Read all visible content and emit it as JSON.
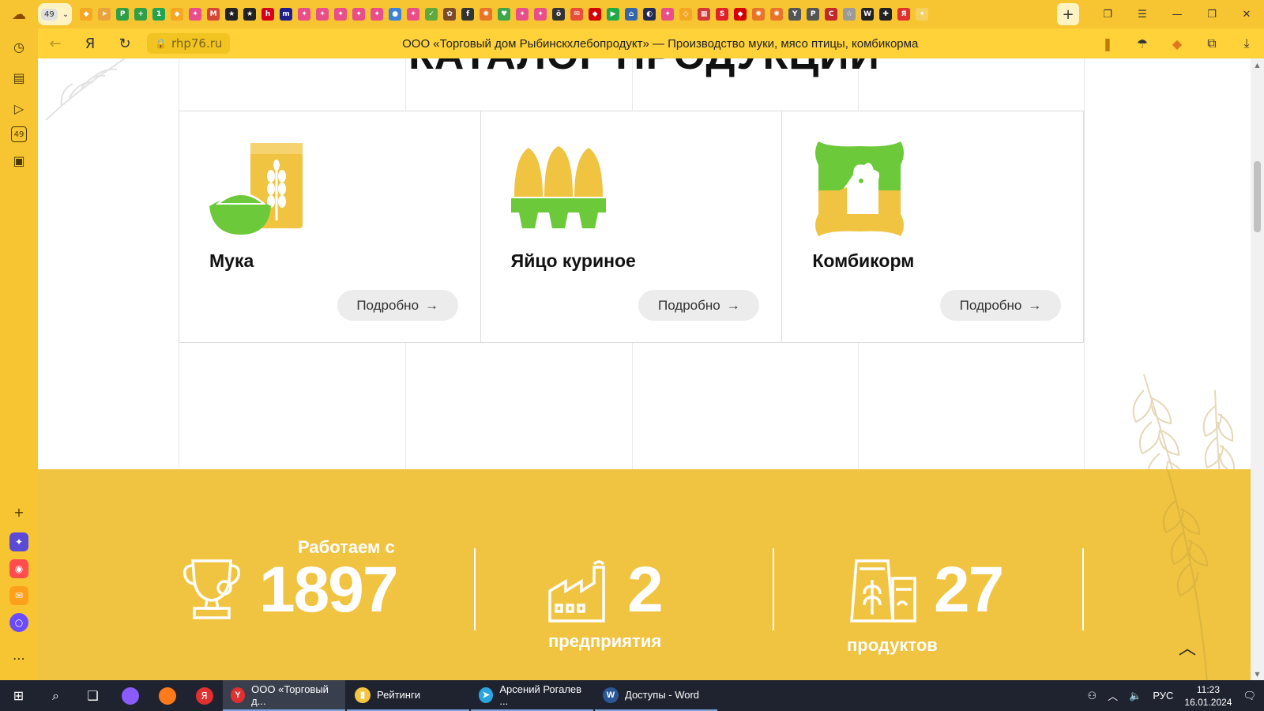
{
  "browser": {
    "tab_counter": "49",
    "tab_icons": [
      {
        "name": "tab-icon-1",
        "color": "#f5a623",
        "glyph": "◆"
      },
      {
        "name": "tab-icon-2",
        "color": "#e8a33a",
        "glyph": "➤"
      },
      {
        "name": "tab-icon-3",
        "color": "#2e9f46",
        "glyph": "P"
      },
      {
        "name": "tab-icon-4",
        "color": "#2e9f46",
        "glyph": "+"
      },
      {
        "name": "tab-icon-5",
        "color": "#22a352",
        "glyph": "1"
      },
      {
        "name": "tab-icon-6",
        "color": "#f5a623",
        "glyph": "◆"
      },
      {
        "name": "tab-icon-7",
        "color": "#e84e89",
        "glyph": "✦"
      },
      {
        "name": "tab-icon-8",
        "color": "#d44638",
        "glyph": "M"
      },
      {
        "name": "tab-icon-9",
        "color": "#222222",
        "glyph": "★"
      },
      {
        "name": "tab-icon-10",
        "color": "#222222",
        "glyph": "★"
      },
      {
        "name": "tab-icon-11",
        "color": "#d6001c",
        "glyph": "h"
      },
      {
        "name": "tab-icon-12",
        "color": "#1e1e8c",
        "glyph": "m"
      },
      {
        "name": "tab-icon-13",
        "color": "#e84e89",
        "glyph": "✦"
      },
      {
        "name": "tab-icon-14",
        "color": "#e84e89",
        "glyph": "✦"
      },
      {
        "name": "tab-icon-15",
        "color": "#e84e89",
        "glyph": "✦"
      },
      {
        "name": "tab-icon-16",
        "color": "#e84e89",
        "glyph": "✦"
      },
      {
        "name": "tab-icon-17",
        "color": "#e84e89",
        "glyph": "✦"
      },
      {
        "name": "tab-icon-18",
        "color": "#3b82d6",
        "glyph": "●"
      },
      {
        "name": "tab-icon-19",
        "color": "#e84e89",
        "glyph": "✦"
      },
      {
        "name": "tab-icon-20",
        "color": "#5fa83b",
        "glyph": "✓"
      },
      {
        "name": "tab-icon-21",
        "color": "#7a4a2a",
        "glyph": "✿"
      },
      {
        "name": "tab-icon-22",
        "color": "#333333",
        "glyph": "f"
      },
      {
        "name": "tab-icon-23",
        "color": "#e8742a",
        "glyph": "✺"
      },
      {
        "name": "tab-icon-24",
        "color": "#3aa84a",
        "glyph": "♥"
      },
      {
        "name": "tab-icon-25",
        "color": "#e84e89",
        "glyph": "✦"
      },
      {
        "name": "tab-icon-26",
        "color": "#e84e89",
        "glyph": "✦"
      },
      {
        "name": "tab-icon-27",
        "color": "#333333",
        "glyph": "ö"
      },
      {
        "name": "tab-icon-28",
        "color": "#e84e3a",
        "glyph": "✉"
      },
      {
        "name": "tab-icon-29",
        "color": "#d40000",
        "glyph": "◆"
      },
      {
        "name": "tab-icon-30",
        "color": "#1faa4a",
        "glyph": "▶"
      },
      {
        "name": "tab-icon-31",
        "color": "#3366aa",
        "glyph": "⌂"
      },
      {
        "name": "tab-icon-32",
        "color": "#222a55",
        "glyph": "◐"
      },
      {
        "name": "tab-icon-33",
        "color": "#e84e89",
        "glyph": "✦"
      },
      {
        "name": "tab-icon-34",
        "color": "#f5a623",
        "glyph": "◇"
      },
      {
        "name": "tab-icon-35",
        "color": "#d23a3a",
        "glyph": "▦"
      },
      {
        "name": "tab-icon-36",
        "color": "#e0202a",
        "glyph": "S"
      },
      {
        "name": "tab-icon-37",
        "color": "#d40000",
        "glyph": "◆"
      },
      {
        "name": "tab-icon-38",
        "color": "#e8742a",
        "glyph": "✺"
      },
      {
        "name": "tab-icon-39",
        "color": "#e8742a",
        "glyph": "✺"
      },
      {
        "name": "tab-icon-40",
        "color": "#555555",
        "glyph": "Y"
      },
      {
        "name": "tab-icon-41",
        "color": "#555555",
        "glyph": "P"
      },
      {
        "name": "tab-icon-42",
        "color": "#c0282a",
        "glyph": "C"
      },
      {
        "name": "tab-icon-43",
        "color": "#9a9a9a",
        "glyph": "☆"
      },
      {
        "name": "tab-icon-44",
        "color": "#222222",
        "glyph": "W"
      },
      {
        "name": "tab-icon-45",
        "color": "#222222",
        "glyph": "✚"
      },
      {
        "name": "tab-icon-46",
        "color": "#e03030",
        "glyph": "Я"
      },
      {
        "name": "tab-icon-47",
        "color": "#f5d060",
        "glyph": "✦"
      }
    ],
    "url_domain": "rhp76.ru",
    "page_title": "ООО «Торговый дом Рыбинскхлебопродукт» — Производство муки, мясо птицы, комбикорма",
    "sidebar_counter": "49"
  },
  "page": {
    "catalog_heading": "КАТАЛОГ ПРОДУКЦИИ",
    "products": [
      {
        "title": "Мука",
        "button": "Подробно",
        "icon": "flour-icon"
      },
      {
        "title": "Яйцо куриное",
        "button": "Подробно",
        "icon": "eggs-icon"
      },
      {
        "title": "Комбикорм",
        "button": "Подробно",
        "icon": "feed-bag-icon"
      }
    ],
    "stats": [
      {
        "label_top": "Работаем с",
        "number": "1897",
        "label_bottom": "",
        "icon": "trophy-icon"
      },
      {
        "label_top": "",
        "number": "2",
        "label_bottom": "предприятия",
        "icon": "factory-icon"
      },
      {
        "label_top": "",
        "number": "27",
        "label_bottom": "продуктов",
        "icon": "products-icon"
      }
    ],
    "colors": {
      "accent_yellow": "#f0c340",
      "green": "#6cc93a",
      "browser_yellow": "#f7c531"
    }
  },
  "taskbar": {
    "apps": [
      {
        "label": "ООО «Торговый д...",
        "icon": "yandex-browser-icon",
        "color": "#e03030",
        "glyph": "Y"
      },
      {
        "label": "Рейтинги",
        "icon": "file-explorer-icon",
        "color": "#f5c542",
        "glyph": "▮"
      },
      {
        "label": "Арсений Рогалев ...",
        "icon": "telegram-icon",
        "color": "#2ba5e0",
        "glyph": "➤"
      },
      {
        "label": "Доступы - Word",
        "icon": "word-icon",
        "color": "#2b5797",
        "glyph": "W"
      }
    ],
    "language": "РУС",
    "time": "11:23",
    "date": "16.01.2024"
  }
}
